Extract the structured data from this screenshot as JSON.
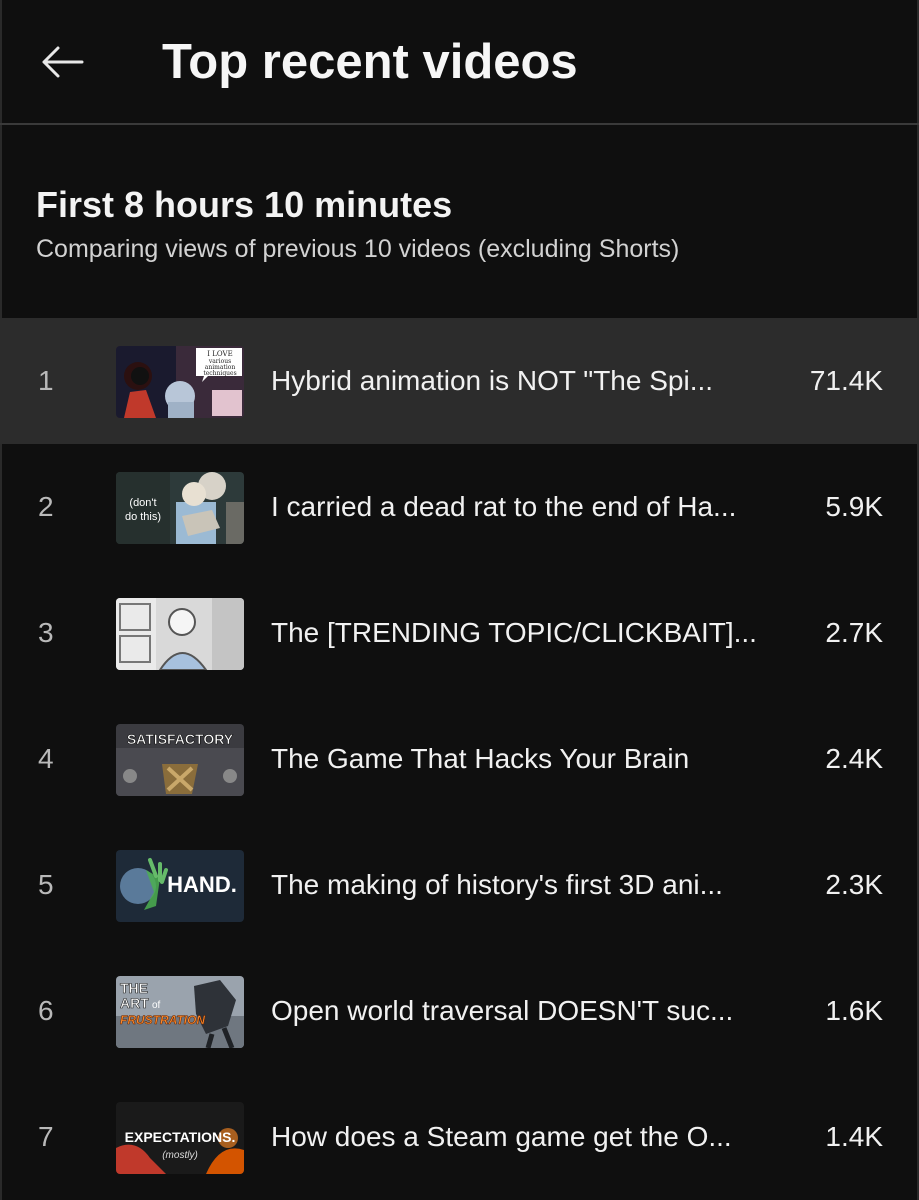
{
  "header": {
    "back_icon": "arrow-left-icon",
    "title": "Top recent videos"
  },
  "section": {
    "title": "First 8 hours 10 minutes",
    "subtitle": "Comparing views of previous 10 videos (excluding Shorts)"
  },
  "videos": [
    {
      "rank": "1",
      "title": "Hybrid animation is NOT \"The Spi...",
      "views": "71.4K",
      "thumb_text": [
        "I LOVE",
        "various",
        "animation",
        "techniques"
      ]
    },
    {
      "rank": "2",
      "title": "I carried a dead rat to the end of Ha...",
      "views": "5.9K",
      "thumb_text": [
        "(don't",
        "do this)"
      ]
    },
    {
      "rank": "3",
      "title": "The [TRENDING TOPIC/CLICKBAIT]...",
      "views": "2.7K",
      "thumb_text": []
    },
    {
      "rank": "4",
      "title": "The Game That Hacks Your Brain",
      "views": "2.4K",
      "thumb_text": [
        "SATISFACTORY"
      ]
    },
    {
      "rank": "5",
      "title": "The making of history's first 3D ani...",
      "views": "2.3K",
      "thumb_text": [
        "HAND."
      ]
    },
    {
      "rank": "6",
      "title": "Open world traversal DOESN'T suc...",
      "views": "1.6K",
      "thumb_text": [
        "THE",
        "ART",
        "of",
        "FRUSTRATION"
      ]
    },
    {
      "rank": "7",
      "title": "How does a Steam game get the O...",
      "views": "1.4K",
      "thumb_text": [
        "EXPECTATIONS.",
        "(mostly)"
      ]
    }
  ],
  "colors": {
    "background": "#0f0f0f",
    "active_row": "#2c2c2c",
    "text": "#f1f1f1",
    "muted": "#b9b9b9"
  }
}
